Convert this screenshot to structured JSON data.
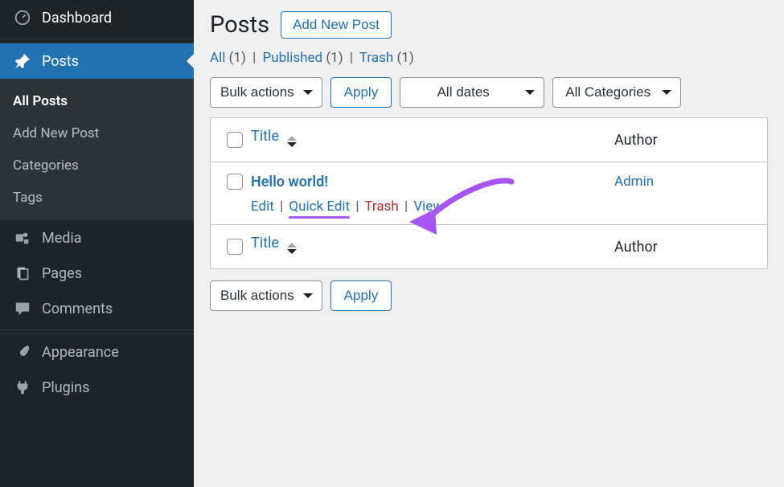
{
  "sidebar": {
    "dashboard": "Dashboard",
    "posts": "Posts",
    "submenu": {
      "all_posts": "All Posts",
      "add_new": "Add New Post",
      "categories": "Categories",
      "tags": "Tags"
    },
    "media": "Media",
    "pages": "Pages",
    "comments": "Comments",
    "appearance": "Appearance",
    "plugins": "Plugins"
  },
  "header": {
    "title": "Posts",
    "add_new": "Add New Post"
  },
  "status": {
    "all_label": "All",
    "all_count": "(1)",
    "published_label": "Published",
    "published_count": "(1)",
    "trash_label": "Trash",
    "trash_count": "(1)"
  },
  "filters": {
    "bulk_actions": "Bulk actions",
    "apply": "Apply",
    "all_dates": "All dates",
    "all_categories": "All Categories"
  },
  "table": {
    "title_header": "Title",
    "author_header": "Author"
  },
  "post": {
    "title": "Hello world!",
    "edit": "Edit",
    "quick_edit": "Quick Edit",
    "trash": "Trash",
    "view": "View",
    "author": "Admin"
  },
  "sep": {
    "pipe": "|"
  }
}
